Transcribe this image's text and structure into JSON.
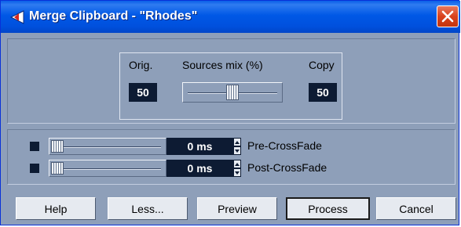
{
  "window": {
    "title": "Merge Clipboard - \"Rhodes\""
  },
  "mix": {
    "orig_label": "Orig.",
    "sources_label": "Sources mix (%)",
    "copy_label": "Copy",
    "orig_value": "50",
    "copy_value": "50",
    "slider_fraction": 0.5
  },
  "crossfade": {
    "pre": {
      "enabled": false,
      "value": "0 ms",
      "label": "Pre-CrossFade",
      "slider_fraction": 0.0
    },
    "post": {
      "enabled": false,
      "value": "0 ms",
      "label": "Post-CrossFade",
      "slider_fraction": 0.0
    }
  },
  "buttons": {
    "help": "Help",
    "less": "Less...",
    "preview": "Preview",
    "process": "Process",
    "cancel": "Cancel"
  },
  "colors": {
    "titlebar": "#0058e6",
    "dialog_bg": "#8e9fb9",
    "value_box": "#0d1b33",
    "close_button": "#d9421c"
  },
  "icons": {
    "title": "cubase-app-icon",
    "close": "close-icon"
  }
}
